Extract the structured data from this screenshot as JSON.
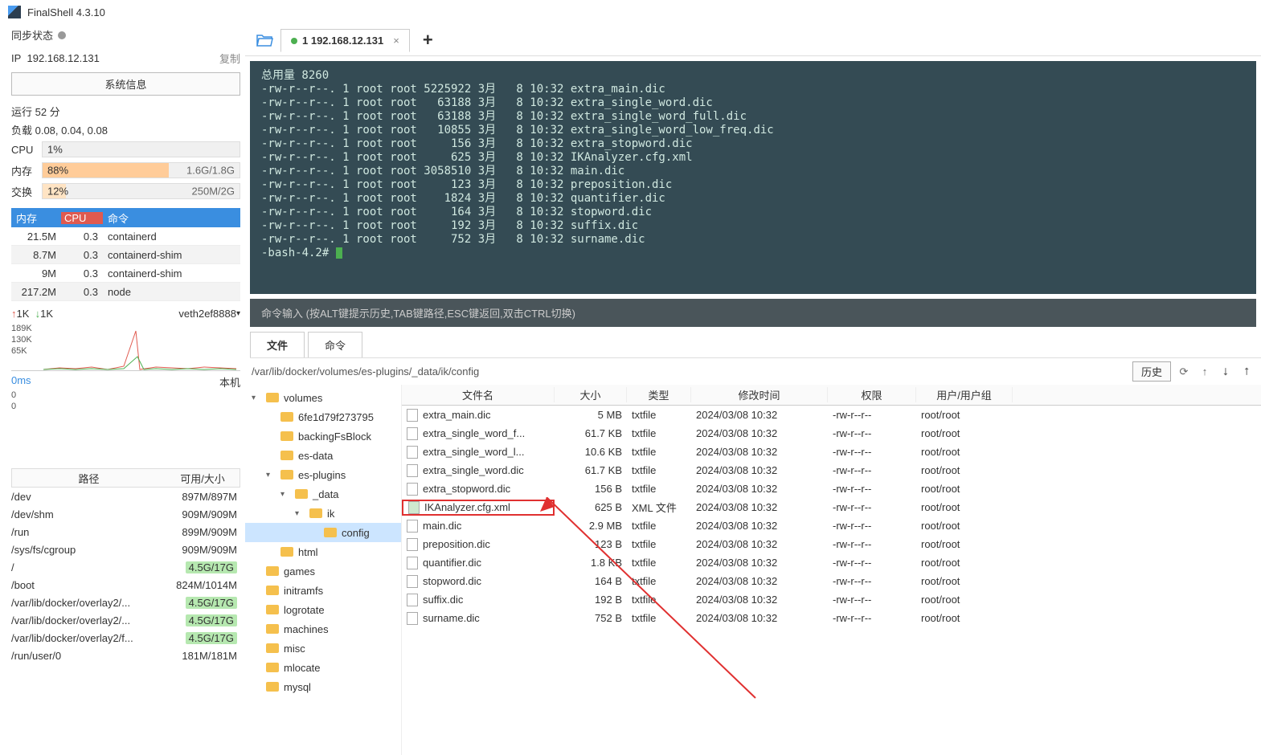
{
  "app": {
    "title": "FinalShell 4.3.10"
  },
  "sidebar": {
    "sync_label": "同步状态",
    "ip_prefix": "IP",
    "ip_value": "192.168.12.131",
    "copy_label": "复制",
    "sysinfo_btn": "系统信息",
    "uptime_label": "运行 52 分",
    "load_label": "负载 0.08, 0.04, 0.08",
    "cpu_label": "CPU",
    "cpu_pct": "1%",
    "mem_label": "内存",
    "mem_pct": "88%",
    "mem_val": "1.6G/1.8G",
    "swap_label": "交换",
    "swap_pct": "12%",
    "swap_val": "250M/2G",
    "proc_headers": {
      "mem": "内存",
      "cpu": "CPU",
      "cmd": "命令"
    },
    "procs": [
      {
        "mem": "21.5M",
        "cpu": "0.3",
        "cmd": "containerd"
      },
      {
        "mem": "8.7M",
        "cpu": "0.3",
        "cmd": "containerd-shim"
      },
      {
        "mem": "9M",
        "cpu": "0.3",
        "cmd": "containerd-shim"
      },
      {
        "mem": "217.2M",
        "cpu": "0.3",
        "cmd": "node"
      }
    ],
    "net_up": "1K",
    "net_down": "1K",
    "net_iface": "veth2ef8888",
    "y0": "189K",
    "y1": "130K",
    "y2": "65K",
    "latency": "0ms",
    "latency_host": "本机",
    "lat_y0": "0",
    "lat_y1": "0",
    "disk_headers": {
      "path": "路径",
      "avail": "可用/大小"
    },
    "disks": [
      {
        "path": "/dev",
        "val": "897M/897M"
      },
      {
        "path": "/dev/shm",
        "val": "909M/909M"
      },
      {
        "path": "/run",
        "val": "899M/909M"
      },
      {
        "path": "/sys/fs/cgroup",
        "val": "909M/909M"
      },
      {
        "path": "/",
        "val": "4.5G/17G",
        "badge": true
      },
      {
        "path": "/boot",
        "val": "824M/1014M"
      },
      {
        "path": "/var/lib/docker/overlay2/...",
        "val": "4.5G/17G",
        "badge": true
      },
      {
        "path": "/var/lib/docker/overlay2/...",
        "val": "4.5G/17G",
        "badge": true
      },
      {
        "path": "/var/lib/docker/overlay2/f...",
        "val": "4.5G/17G",
        "badge": true
      },
      {
        "path": "/run/user/0",
        "val": "181M/181M"
      }
    ]
  },
  "tabs": {
    "term_tab": "1 192.168.12.131"
  },
  "terminal": {
    "lines": [
      "总用量 8260",
      "-rw-r--r--. 1 root root 5225922 3月   8 10:32 extra_main.dic",
      "-rw-r--r--. 1 root root   63188 3月   8 10:32 extra_single_word.dic",
      "-rw-r--r--. 1 root root   63188 3月   8 10:32 extra_single_word_full.dic",
      "-rw-r--r--. 1 root root   10855 3月   8 10:32 extra_single_word_low_freq.dic",
      "-rw-r--r--. 1 root root     156 3月   8 10:32 extra_stopword.dic",
      "-rw-r--r--. 1 root root     625 3月   8 10:32 IKAnalyzer.cfg.xml",
      "-rw-r--r--. 1 root root 3058510 3月   8 10:32 main.dic",
      "-rw-r--r--. 1 root root     123 3月   8 10:32 preposition.dic",
      "-rw-r--r--. 1 root root    1824 3月   8 10:32 quantifier.dic",
      "-rw-r--r--. 1 root root     164 3月   8 10:32 stopword.dic",
      "-rw-r--r--. 1 root root     192 3月   8 10:32 suffix.dic",
      "-rw-r--r--. 1 root root     752 3月   8 10:32 surname.dic",
      "-bash-4.2# "
    ],
    "placeholder": "命令输入 (按ALT键提示历史,TAB键路径,ESC键返回,双击CTRL切换)"
  },
  "bottom": {
    "tab_file": "文件",
    "tab_cmd": "命令",
    "path": "/var/lib/docker/volumes/es-plugins/_data/ik/config",
    "history_btn": "历史",
    "tree": [
      {
        "indent": 0,
        "exp": "▾",
        "name": "volumes"
      },
      {
        "indent": 1,
        "exp": "",
        "name": "6fe1d79f273795"
      },
      {
        "indent": 1,
        "exp": "",
        "name": "backingFsBlock"
      },
      {
        "indent": 1,
        "exp": "",
        "name": "es-data"
      },
      {
        "indent": 1,
        "exp": "▾",
        "name": "es-plugins"
      },
      {
        "indent": 2,
        "exp": "▾",
        "name": "_data"
      },
      {
        "indent": 3,
        "exp": "▾",
        "name": "ik"
      },
      {
        "indent": 4,
        "exp": "",
        "name": "config",
        "sel": true
      },
      {
        "indent": 1,
        "exp": "",
        "name": "html"
      },
      {
        "indent": 0,
        "exp": "",
        "name": "games"
      },
      {
        "indent": 0,
        "exp": "",
        "name": "initramfs"
      },
      {
        "indent": 0,
        "exp": "",
        "name": "logrotate"
      },
      {
        "indent": 0,
        "exp": "",
        "name": "machines"
      },
      {
        "indent": 0,
        "exp": "",
        "name": "misc"
      },
      {
        "indent": 0,
        "exp": "",
        "name": "mlocate"
      },
      {
        "indent": 0,
        "exp": "",
        "name": "mysql"
      }
    ],
    "file_headers": {
      "name": "文件名",
      "size": "大小",
      "type": "类型",
      "date": "修改时间",
      "perm": "权限",
      "user": "用户/用户组"
    },
    "files": [
      {
        "name": "extra_main.dic",
        "size": "5 MB",
        "type": "txtfile",
        "date": "2024/03/08 10:32",
        "perm": "-rw-r--r--",
        "user": "root/root"
      },
      {
        "name": "extra_single_word_f...",
        "size": "61.7 KB",
        "type": "txtfile",
        "date": "2024/03/08 10:32",
        "perm": "-rw-r--r--",
        "user": "root/root"
      },
      {
        "name": "extra_single_word_l...",
        "size": "10.6 KB",
        "type": "txtfile",
        "date": "2024/03/08 10:32",
        "perm": "-rw-r--r--",
        "user": "root/root"
      },
      {
        "name": "extra_single_word.dic",
        "size": "61.7 KB",
        "type": "txtfile",
        "date": "2024/03/08 10:32",
        "perm": "-rw-r--r--",
        "user": "root/root"
      },
      {
        "name": "extra_stopword.dic",
        "size": "156 B",
        "type": "txtfile",
        "date": "2024/03/08 10:32",
        "perm": "-rw-r--r--",
        "user": "root/root"
      },
      {
        "name": "IKAnalyzer.cfg.xml",
        "size": "625 B",
        "type": "XML 文件",
        "date": "2024/03/08 10:32",
        "perm": "-rw-r--r--",
        "user": "root/root",
        "xml": true,
        "hl": true
      },
      {
        "name": "main.dic",
        "size": "2.9 MB",
        "type": "txtfile",
        "date": "2024/03/08 10:32",
        "perm": "-rw-r--r--",
        "user": "root/root"
      },
      {
        "name": "preposition.dic",
        "size": "123 B",
        "type": "txtfile",
        "date": "2024/03/08 10:32",
        "perm": "-rw-r--r--",
        "user": "root/root"
      },
      {
        "name": "quantifier.dic",
        "size": "1.8 KB",
        "type": "txtfile",
        "date": "2024/03/08 10:32",
        "perm": "-rw-r--r--",
        "user": "root/root"
      },
      {
        "name": "stopword.dic",
        "size": "164 B",
        "type": "txtfile",
        "date": "2024/03/08 10:32",
        "perm": "-rw-r--r--",
        "user": "root/root"
      },
      {
        "name": "suffix.dic",
        "size": "192 B",
        "type": "txtfile",
        "date": "2024/03/08 10:32",
        "perm": "-rw-r--r--",
        "user": "root/root"
      },
      {
        "name": "surname.dic",
        "size": "752 B",
        "type": "txtfile",
        "date": "2024/03/08 10:32",
        "perm": "-rw-r--r--",
        "user": "root/root"
      }
    ]
  }
}
